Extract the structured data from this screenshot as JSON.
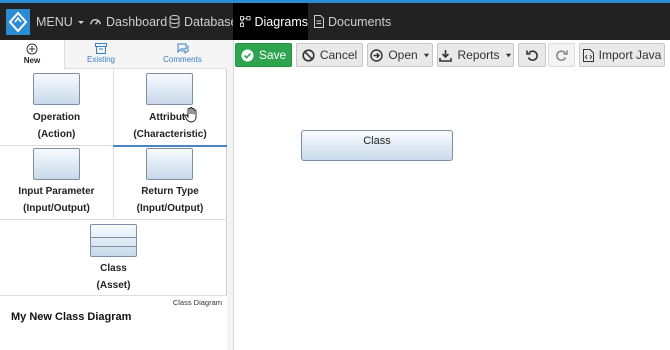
{
  "nav": {
    "menu_label": "MENU",
    "items": [
      {
        "label": "Dashboard",
        "icon": "dashboard-icon"
      },
      {
        "label": "Database",
        "icon": "database-icon"
      },
      {
        "label": "Diagrams",
        "icon": "diagram-icon",
        "active": true
      },
      {
        "label": "Documents",
        "icon": "document-icon"
      }
    ],
    "colors": {
      "bar": "#222222",
      "accent": "#2b8bd3"
    }
  },
  "palette_tabs": [
    {
      "label": "New",
      "icon": "plus-circle-icon"
    },
    {
      "label": "Existing",
      "icon": "archive-icon"
    },
    {
      "label": "Comments",
      "icon": "comments-icon"
    }
  ],
  "palette_items": [
    {
      "name": "Operation",
      "type": "(Action)"
    },
    {
      "name": "Attribute",
      "type": "(Characteristic)"
    },
    {
      "name": "Input Parameter",
      "type": "(Input/Output)"
    },
    {
      "name": "Return Type",
      "type": "(Input/Output)"
    },
    {
      "name": "Class",
      "type": "(Asset)"
    }
  ],
  "diagram": {
    "kind": "Class Diagram",
    "name": "My New Class Diagram"
  },
  "toolbar": {
    "save": "Save",
    "cancel": "Cancel",
    "open": "Open",
    "reports": "Reports",
    "import_java": "Import Java"
  },
  "canvas": {
    "nodes": [
      {
        "label": "Class"
      }
    ]
  }
}
